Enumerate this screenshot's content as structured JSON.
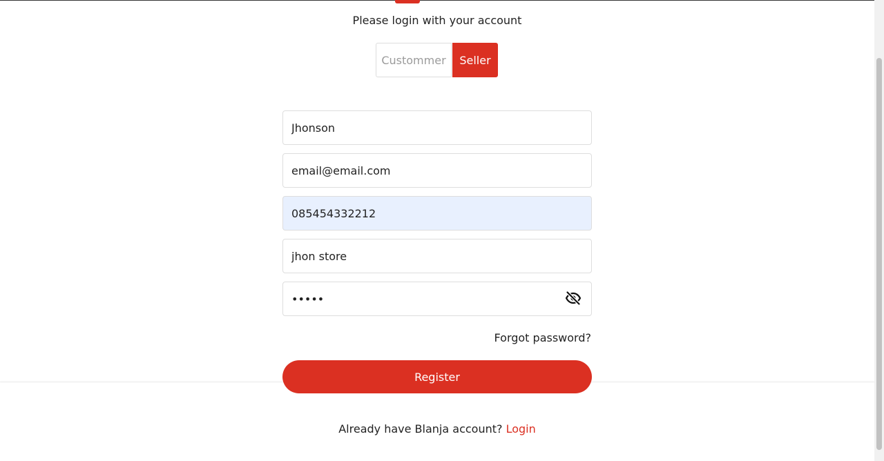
{
  "header": {
    "subtitle": "Please login with your account"
  },
  "role_toggle": {
    "customer_label": "Custommer",
    "seller_label": "Seller",
    "selected": "Seller"
  },
  "form": {
    "name_value": "Jhonson",
    "email_value": "email@email.com",
    "phone_value": "085454332212",
    "store_value": "jhon store",
    "password_value": "abcde",
    "forgot_label": "Forgot password?",
    "register_label": "Register"
  },
  "footer": {
    "prompt": "Already have Blanja account?",
    "login_label": "Login"
  },
  "icons": {
    "password_toggle": "eye-slash-icon"
  },
  "colors": {
    "accent": "#db3022",
    "autofill_bg": "#e8f0fe"
  }
}
